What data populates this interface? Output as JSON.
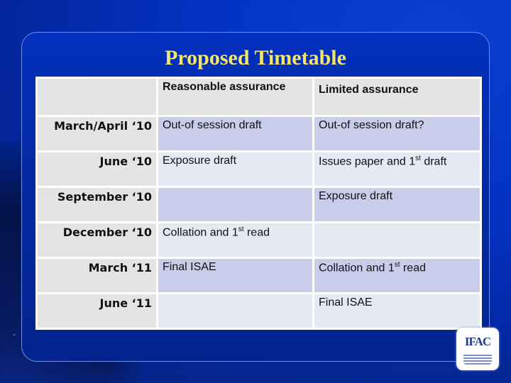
{
  "slide": {
    "title": "Proposed Timetable"
  },
  "table": {
    "headers": [
      "",
      "Reasonable assurance",
      "Limited assurance"
    ],
    "rows": [
      {
        "period": "March/April ‘10",
        "reasonable": "Out-of session draft",
        "limited": "Out-of session draft?"
      },
      {
        "period": "June ‘10",
        "reasonable": "Exposure draft",
        "limited": "Issues paper and 1st draft"
      },
      {
        "period": "September ‘10",
        "reasonable": "",
        "limited": "Exposure draft"
      },
      {
        "period": "December ‘10",
        "reasonable": "Collation and 1st read",
        "limited": ""
      },
      {
        "period": "March ‘11",
        "reasonable": "Final ISAE",
        "limited": "Collation and 1st read"
      },
      {
        "period": "June ‘11",
        "reasonable": "",
        "limited": "Final ISAE"
      }
    ]
  },
  "logo": {
    "text": "IFAC",
    "icon": "ifac-logo-icon"
  },
  "colors": {
    "title": "#f4e46c",
    "background": "#0433c4",
    "row_dark": "#c9cdea",
    "row_light": "#e6e8f4",
    "label_cell": "#e4e4e4"
  }
}
